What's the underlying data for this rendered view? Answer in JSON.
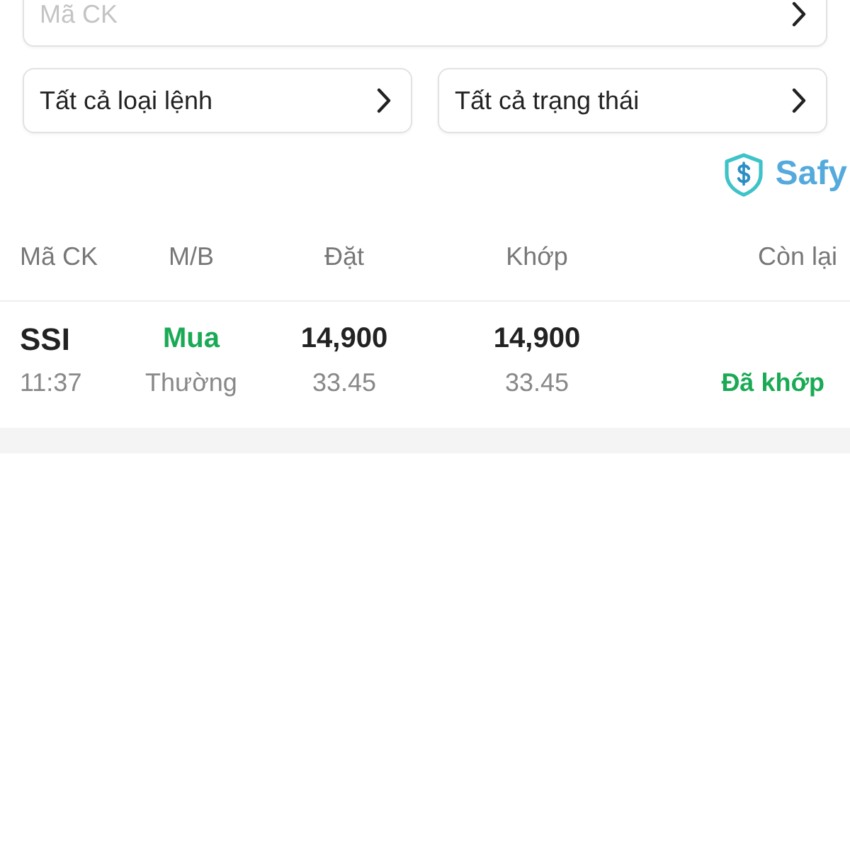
{
  "search": {
    "placeholder": "Mã CK"
  },
  "filters": [
    {
      "label": "Tất cả loại lệnh"
    },
    {
      "label": "Tất cả trạng thái"
    }
  ],
  "brand": {
    "name": "Safy"
  },
  "table": {
    "columns": [
      "Mã CK",
      "M/B",
      "Đặt",
      "Khớp",
      "Còn lại"
    ],
    "rows": [
      {
        "symbol": "SSI",
        "time": "11:37",
        "side": {
          "text": "Mua",
          "kind": "buy"
        },
        "order_type": "Thường",
        "order_price": "14,900",
        "order_volume": "33.45",
        "match_price": "14,900",
        "match_volume": "33.45",
        "status": {
          "text": "Đã khớp",
          "kind": "matched"
        }
      }
    ]
  }
}
